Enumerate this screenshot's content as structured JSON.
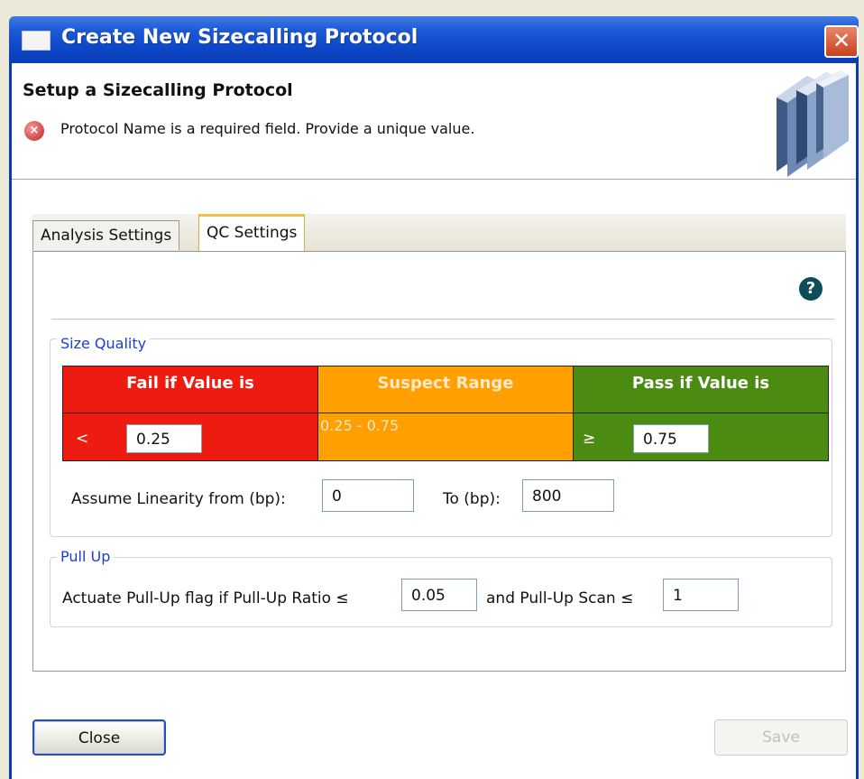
{
  "window": {
    "title": "Create New Sizecalling Protocol",
    "close_glyph": "✕"
  },
  "header": {
    "title": "Setup a Sizecalling Protocol",
    "error_icon": "error-icon",
    "error_glyph": "×",
    "error_message": "Protocol Name is a required field. Provide a unique value."
  },
  "tabs": [
    {
      "label": "Analysis Settings",
      "selected": false
    },
    {
      "label": "QC Settings",
      "selected": true
    }
  ],
  "help_glyph": "?",
  "size_quality": {
    "label": "Size Quality",
    "fail_header": "Fail if Value is",
    "suspect_header": "Suspect Range",
    "pass_header": "Pass if Value is",
    "fail_operator": "<",
    "fail_value": "0.25",
    "suspect_range": "0.25 - 0.75",
    "pass_operator": "≥",
    "pass_value": "0.75",
    "colors": {
      "fail": "#ee1c10",
      "suspect": "#ff9f00",
      "pass": "#4c8b12"
    }
  },
  "linearity": {
    "from_label": "Assume Linearity from (bp):",
    "from_value": "0",
    "to_label": "To (bp):",
    "to_value": "800"
  },
  "pull_up": {
    "label": "Pull Up",
    "ratio_label": "Actuate Pull-Up flag if Pull-Up Ratio ≤",
    "ratio_value": "0.05",
    "scan_label": "and Pull-Up Scan ≤",
    "scan_value": "1"
  },
  "buttons": {
    "close": "Close",
    "save": "Save"
  }
}
